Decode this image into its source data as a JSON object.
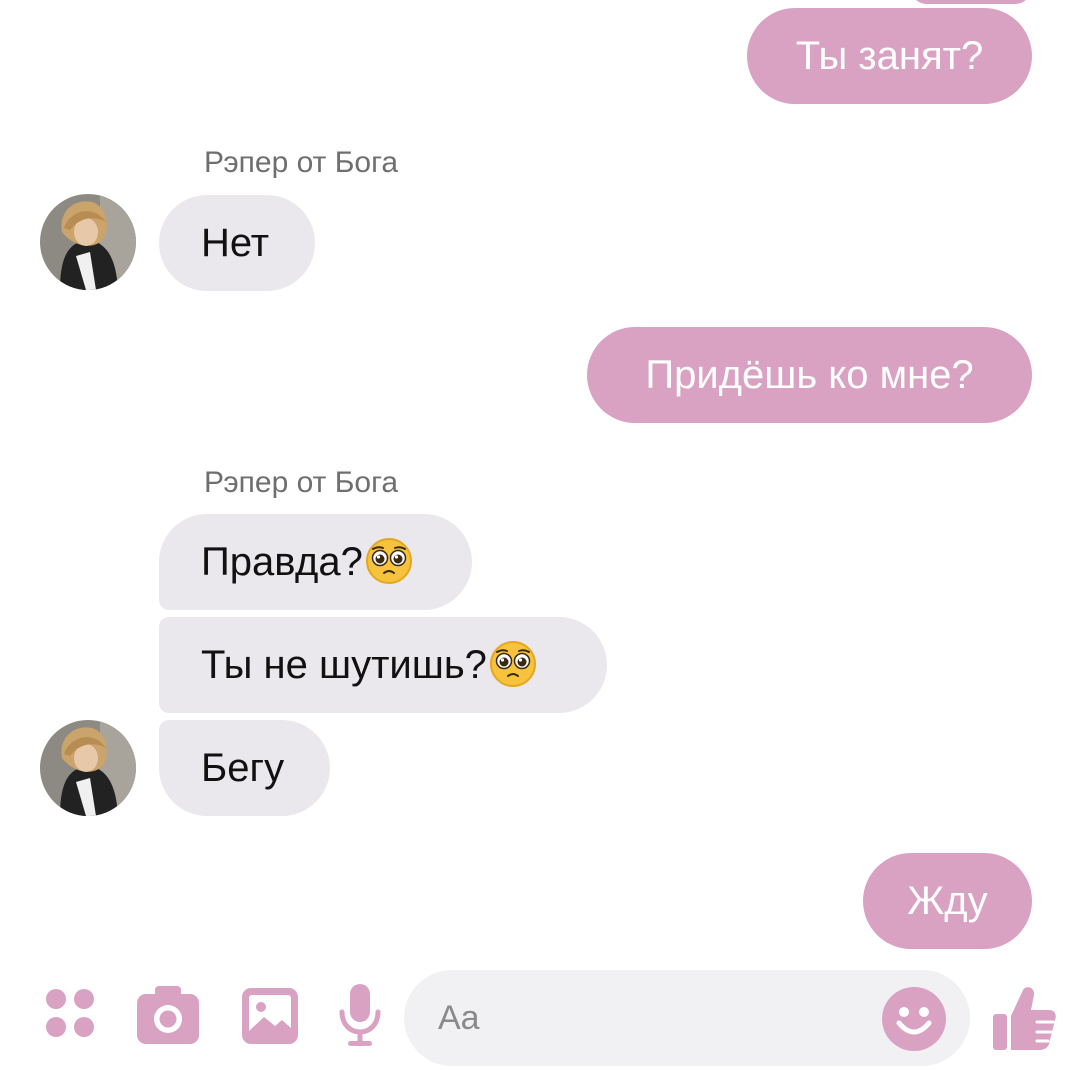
{
  "conversation": {
    "sender_name": "Рэпер от Бога",
    "messages": [
      {
        "from": "me",
        "text": "Ты занят?"
      },
      {
        "from": "them",
        "text": "Нет"
      },
      {
        "from": "me",
        "text": "Придёшь ко мне?"
      },
      {
        "from": "them",
        "text": "Правда?",
        "emoji": "pleading-face-emoji"
      },
      {
        "from": "them",
        "text": "Ты не шутишь?",
        "emoji": "pleading-face-emoji"
      },
      {
        "from": "them",
        "text": "Бегу"
      },
      {
        "from": "me",
        "text": "Жду"
      }
    ]
  },
  "composer": {
    "placeholder": "Aa",
    "icons": [
      "apps-icon",
      "camera-icon",
      "image-icon",
      "microphone-icon",
      "emoji-icon",
      "thumbs-up-icon"
    ]
  },
  "colors": {
    "accent": "#d9a2c2",
    "incoming_bubble": "#ebe8ed",
    "outgoing_text": "#ffffff",
    "sender_name": "#6f6f6f",
    "input_bg": "#f1f0f3"
  }
}
